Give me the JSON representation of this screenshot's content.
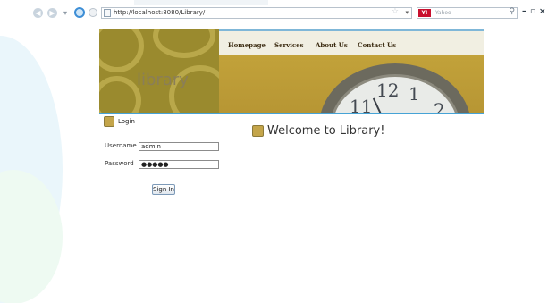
{
  "browser": {
    "url": "http://localhost:8080/Library/",
    "search_placeholder": "Yahoo",
    "search_engine_badge": "Y!",
    "window_controls": [
      "–",
      "▫",
      "×"
    ]
  },
  "banner": {
    "site_name": "library",
    "nav": [
      "Homepage",
      "Services",
      "About Us",
      "Contact Us"
    ],
    "clock_numerals": [
      "12",
      "1",
      "11",
      "2"
    ]
  },
  "login": {
    "title": "Login",
    "username_label": "Username",
    "username_value": "admin",
    "password_label": "Password",
    "password_value": "●●●●●",
    "submit_label": "Sign In"
  },
  "main": {
    "welcome": "Welcome to Library!"
  },
  "colors": {
    "banner_gold": "#a89437",
    "accent_blue": "#46a3d6"
  }
}
